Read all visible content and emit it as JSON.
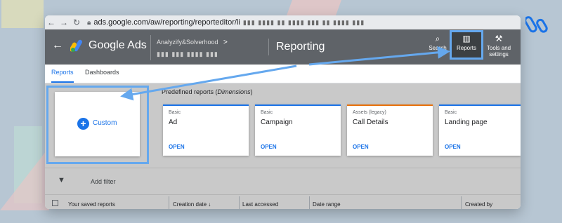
{
  "browser": {
    "back_icon": "back-arrow-icon",
    "url": "ads.google.com/aw/reporting/reporteditor/li",
    "url_obscured": "▮▮▮ ▮▮▮▮ ▮▮ ▮▮▮▮ ▮▮▮ ▮▮ ▮▮▮▮ ▮▮▮"
  },
  "header": {
    "back_label": "←",
    "product_name": "Google Ads",
    "account_name": "Analyzify&Solverhood",
    "account_chevron": ">",
    "account_id": "▮▮▮ ▮▮▮ ▮▮▮▮ ▮▮▮",
    "section_title": "Reporting",
    "search_label": "Search",
    "reports_label": "Reports",
    "tools_label": "Tools and settings"
  },
  "tabs": {
    "reports": "Reports",
    "dashboards": "Dashboards"
  },
  "custom_card": {
    "plus": "+",
    "label": "Custom"
  },
  "predefined": {
    "title_prefix": "Predefined reports (",
    "title_em": "Dimensions",
    "title_suffix": ")"
  },
  "report_cards": [
    {
      "category": "Basic",
      "name": "Ad",
      "action": "OPEN"
    },
    {
      "category": "Basic",
      "name": "Campaign",
      "action": "OPEN"
    },
    {
      "category": "Assets (legacy)",
      "name": "Call Details",
      "action": "OPEN"
    },
    {
      "category": "Basic",
      "name": "Landing page",
      "action": "OPEN"
    }
  ],
  "filter": {
    "label": "Add filter"
  },
  "table": {
    "col_saved": "Your saved reports",
    "col_created": "Creation date ↓",
    "col_accessed": "Last accessed",
    "col_range": "Date range",
    "col_created_by": "Created by"
  },
  "colors": {
    "accent": "#1a73e8",
    "highlight": "#65a8ee",
    "legacy": "#e8710a"
  }
}
